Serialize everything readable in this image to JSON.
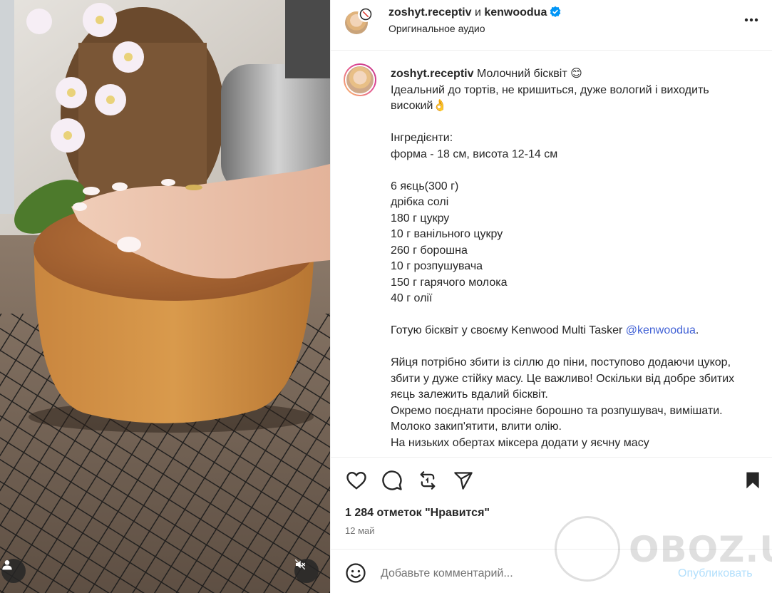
{
  "header": {
    "user1": "zoshyt.receptiv",
    "and": "и",
    "user2": "kenwoodua",
    "audio": "Оригинальное аудио"
  },
  "caption": {
    "username": "zoshyt.receptiv",
    "line1": "Молочний бісквіт 😊",
    "body_intro": "Ідеальний до тортів, не кришиться, дуже вологий і виходить високий👌\n\nІнгредієнти:\nформа - 18 см, висота 12-14 см\n\n6 яєць(300 г)\nдрібка солі\n180 г цукру\n10 г ванільного цукру\n260 г борошна\n10 г розпушувача\n150 г гарячого молока\n40 г олії\n\nГотую бісквіт у своєму Kenwood Multi Tasker ",
    "mention": "@kenwoodua",
    "body_rest": ".\n\nЯйця потрібно збити із сіллю до піни, поступово додаючи цукор, збити у дуже стійку масу. Це важливо! Оскільки від добре збитих яєць залежить вдалий бісквіт.\nОкремо поєднати просіяне борошно та розпушувач, вимішати.\nМолоко закип'ятити, влити олію.\nНа низьких обертах міксера додати у яєчну масу"
  },
  "actions": {
    "like": "heart-icon",
    "comment": "comment-icon",
    "share": "repost-icon",
    "send": "send-icon",
    "save": "bookmark-icon"
  },
  "likes_text": "1 284 отметок \"Нравится\"",
  "date": "12 май",
  "comment_box": {
    "placeholder": "Добавьте комментарий...",
    "publish": "Опубликовать"
  },
  "watermark": "OBOZ.UA",
  "colors": {
    "link": "#4262d6",
    "publish_disabled": "#b2dffc",
    "verified": "#0095f6",
    "muted_text": "#737373"
  }
}
